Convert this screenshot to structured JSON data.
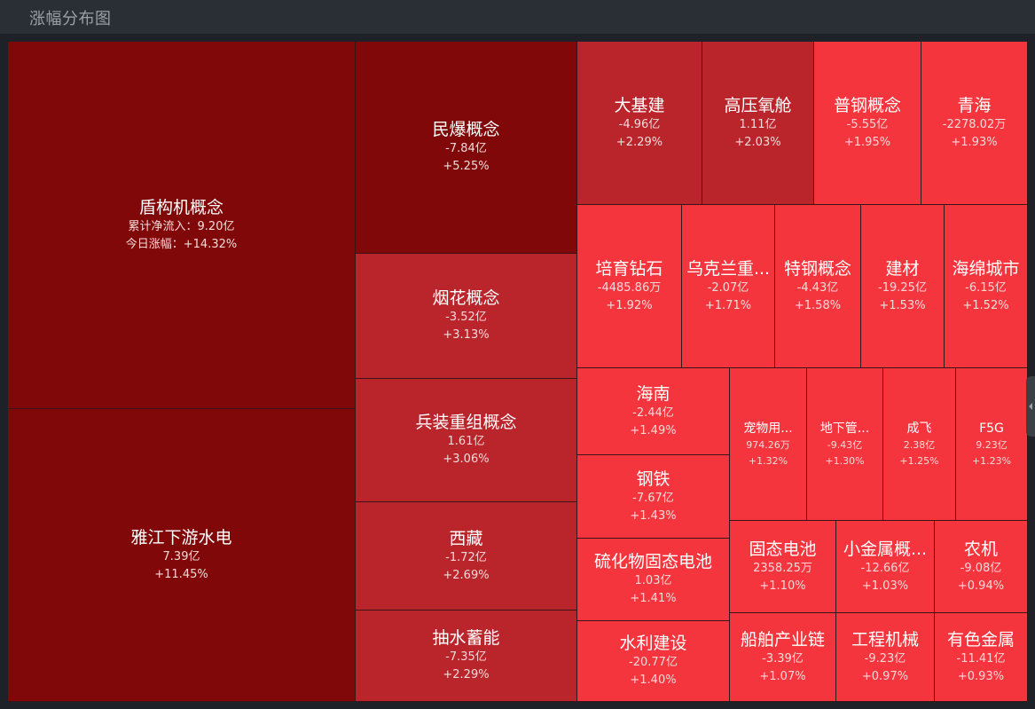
{
  "header": {
    "title": "涨幅分布图"
  },
  "colors": {
    "dark": "#800808",
    "mid": "#b9252b",
    "bright": "#f5353d"
  },
  "chart_data": {
    "type": "treemap",
    "title": "涨幅分布图",
    "items": [
      {
        "name": "盾构机概念",
        "flow_label": "累计净流入：",
        "flow": "9.20亿",
        "change_label": "今日涨幅：",
        "change": "+14.32%",
        "pct": 14.32
      },
      {
        "name": "雅江下游水电",
        "flow": "7.39亿",
        "change": "+11.45%",
        "pct": 11.45
      },
      {
        "name": "民爆概念",
        "flow": "-7.84亿",
        "change": "+5.25%",
        "pct": 5.25
      },
      {
        "name": "烟花概念",
        "flow": "-3.52亿",
        "change": "+3.13%",
        "pct": 3.13
      },
      {
        "name": "兵装重组概念",
        "flow": "1.61亿",
        "change": "+3.06%",
        "pct": 3.06
      },
      {
        "name": "西藏",
        "flow": "-1.72亿",
        "change": "+2.69%",
        "pct": 2.69
      },
      {
        "name": "抽水蓄能",
        "flow": "-7.35亿",
        "change": "+2.29%",
        "pct": 2.29
      },
      {
        "name": "大基建",
        "flow": "-4.96亿",
        "change": "+2.29%",
        "pct": 2.29
      },
      {
        "name": "高压氧舱",
        "flow": "1.11亿",
        "change": "+2.03%",
        "pct": 2.03
      },
      {
        "name": "普钢概念",
        "flow": "-5.55亿",
        "change": "+1.95%",
        "pct": 1.95
      },
      {
        "name": "青海",
        "flow": "-2278.02万",
        "change": "+1.93%",
        "pct": 1.93
      },
      {
        "name": "培育钻石",
        "flow": "-4485.86万",
        "change": "+1.92%",
        "pct": 1.92
      },
      {
        "name": "乌克兰重...",
        "flow": "-2.07亿",
        "change": "+1.71%",
        "pct": 1.71
      },
      {
        "name": "特钢概念",
        "flow": "-4.43亿",
        "change": "+1.58%",
        "pct": 1.58
      },
      {
        "name": "建材",
        "flow": "-19.25亿",
        "change": "+1.53%",
        "pct": 1.53
      },
      {
        "name": "海绵城市",
        "flow": "-6.15亿",
        "change": "+1.52%",
        "pct": 1.52
      },
      {
        "name": "海南",
        "flow": "-2.44亿",
        "change": "+1.49%",
        "pct": 1.49
      },
      {
        "name": "钢铁",
        "flow": "-7.67亿",
        "change": "+1.43%",
        "pct": 1.43
      },
      {
        "name": "硫化物固态电池",
        "flow": "1.03亿",
        "change": "+1.41%",
        "pct": 1.41
      },
      {
        "name": "水利建设",
        "flow": "-20.77亿",
        "change": "+1.40%",
        "pct": 1.4
      },
      {
        "name": "宠物用...",
        "flow": "974.26万",
        "change": "+1.32%",
        "pct": 1.32
      },
      {
        "name": "地下管...",
        "flow": "-9.43亿",
        "change": "+1.30%",
        "pct": 1.3
      },
      {
        "name": "成飞",
        "flow": "2.38亿",
        "change": "+1.25%",
        "pct": 1.25
      },
      {
        "name": "F5G",
        "flow": "9.23亿",
        "change": "+1.23%",
        "pct": 1.23
      },
      {
        "name": "固态电池",
        "flow": "2358.25万",
        "change": "+1.10%",
        "pct": 1.1
      },
      {
        "name": "小金属概...",
        "flow": "-12.66亿",
        "change": "+1.03%",
        "pct": 1.03
      },
      {
        "name": "农机",
        "flow": "-9.08亿",
        "change": "+0.94%",
        "pct": 0.94
      },
      {
        "name": "船舶产业链",
        "flow": "-3.39亿",
        "change": "+1.07%",
        "pct": 1.07
      },
      {
        "name": "工程机械",
        "flow": "-9.23亿",
        "change": "+0.97%",
        "pct": 0.97
      },
      {
        "name": "有色金属",
        "flow": "-11.41亿",
        "change": "+0.93%",
        "pct": 0.93
      }
    ]
  }
}
